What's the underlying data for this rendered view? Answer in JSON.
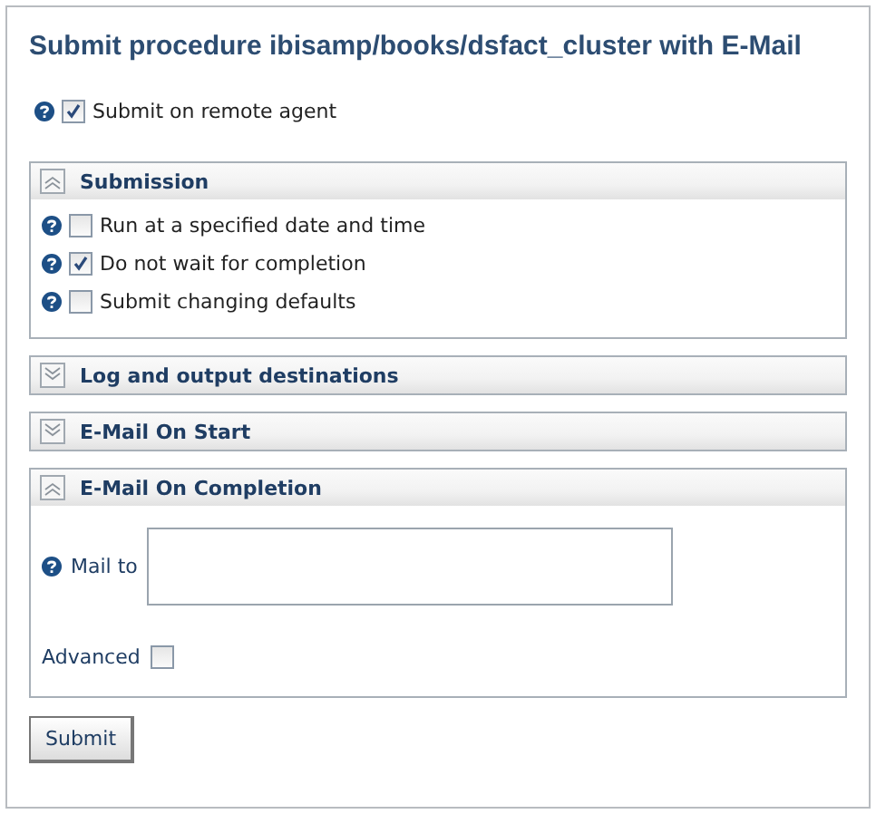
{
  "title": "Submit procedure ibisamp/books/dsfact_cluster with E-Mail",
  "remote_agent": {
    "label": "Submit on remote agent",
    "checked": true
  },
  "sections": [
    {
      "title": "Submission",
      "expanded": true,
      "kind": "options",
      "options": [
        {
          "label": "Run at a specified date and time",
          "checked": false
        },
        {
          "label": "Do not wait for completion",
          "checked": true
        },
        {
          "label": "Submit changing defaults",
          "checked": false
        }
      ]
    },
    {
      "title": "Log and output destinations",
      "expanded": false
    },
    {
      "title": "E-Mail On Start",
      "expanded": false
    },
    {
      "title": "E-Mail On Completion",
      "expanded": true,
      "kind": "mail",
      "mail_to": {
        "label": "Mail to"
      },
      "advanced": {
        "label": "Advanced",
        "checked": false
      }
    }
  ],
  "submit_button": "Submit"
}
